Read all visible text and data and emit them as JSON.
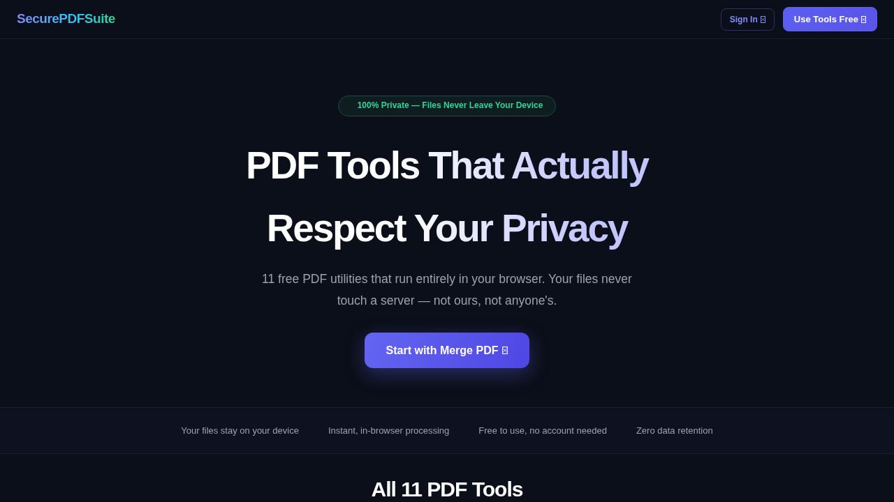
{
  "header": {
    "logo": "SecurePDFSuite",
    "buttons": [
      {
        "label": "Sign In",
        "kind": "outline"
      },
      {
        "label": "Use Tools Free",
        "kind": "primary"
      }
    ]
  },
  "hero": {
    "badge": "100% Private — Files Never Leave Your Device",
    "title": "PDF Tools That Actually Respect Your Privacy",
    "subtitle": "11 free PDF utilities that run entirely in your browser. Your files never touch a server — not ours, not anyone's.",
    "cta": "Start with Merge PDF"
  },
  "features": [
    "Your files stay on your device",
    "Instant, in-browser processing",
    "Free to use, no account needed",
    "Zero data retention"
  ],
  "tools_section": {
    "heading": "All 11 PDF Tools"
  }
}
